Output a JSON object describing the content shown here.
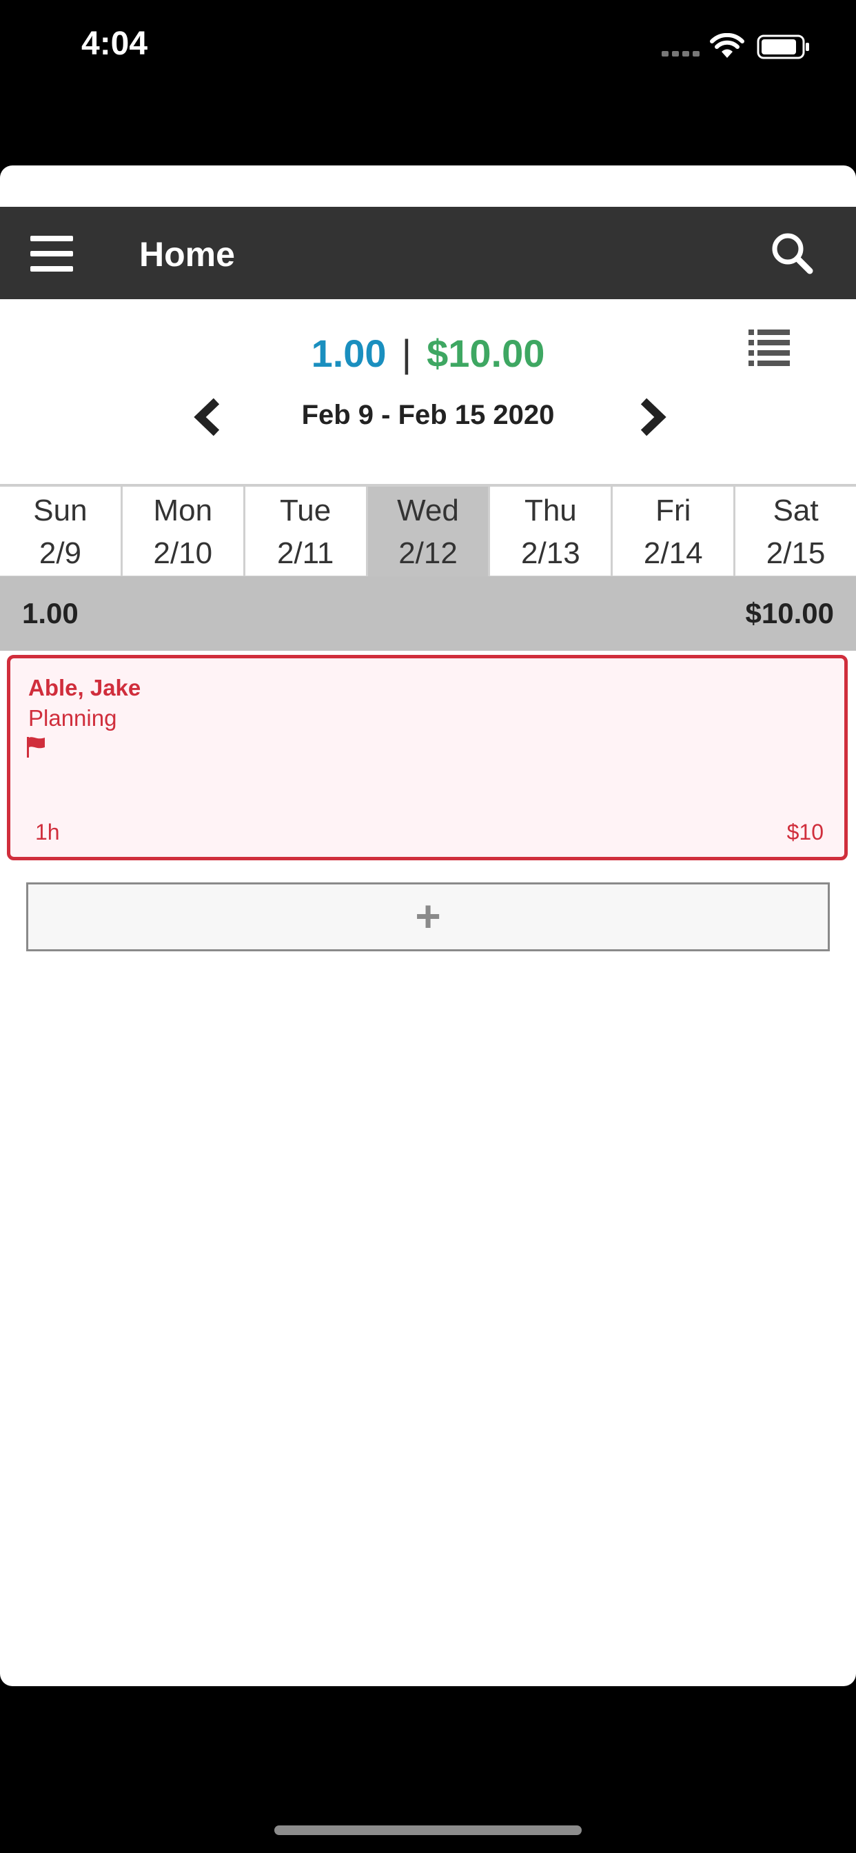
{
  "status_bar": {
    "time": "4:04"
  },
  "navbar": {
    "title": "Home"
  },
  "summary": {
    "hours": "1.00",
    "separator": "|",
    "amount": "$10.00"
  },
  "week": {
    "range": "Feb 9 - Feb 15 2020"
  },
  "days": [
    {
      "name": "Sun",
      "date": "2/9"
    },
    {
      "name": "Mon",
      "date": "2/10"
    },
    {
      "name": "Tue",
      "date": "2/11"
    },
    {
      "name": "Wed",
      "date": "2/12"
    },
    {
      "name": "Thu",
      "date": "2/13"
    },
    {
      "name": "Fri",
      "date": "2/14"
    },
    {
      "name": "Sat",
      "date": "2/15"
    }
  ],
  "selected_day_index": 3,
  "day_total": {
    "hours": "1.00",
    "amount": "$10.00"
  },
  "entry": {
    "name": "Able, Jake",
    "task": "Planning",
    "duration": "1h",
    "amount": "$10"
  },
  "add_button": {
    "label": "+"
  },
  "colors": {
    "hours": "#1a8fbf",
    "money": "#3ea762",
    "entry_accent": "#d02e3c",
    "navbar": "#333333"
  }
}
